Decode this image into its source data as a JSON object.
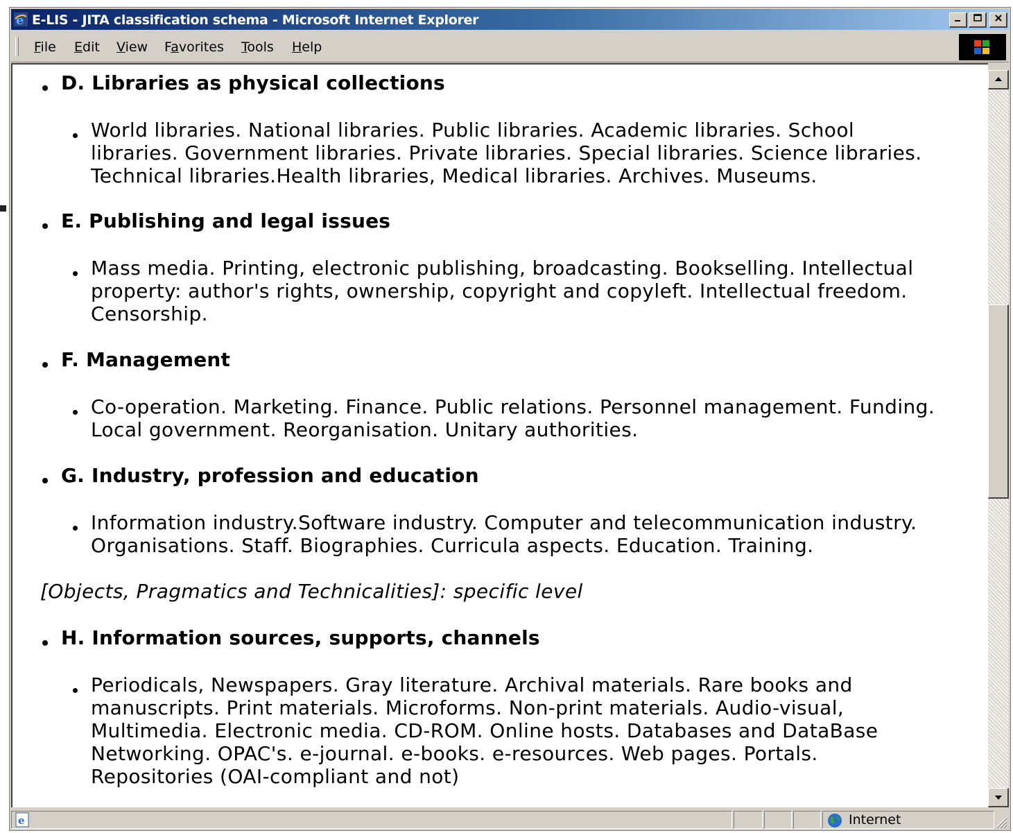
{
  "window": {
    "title": "E-LIS - JITA classification schema - Microsoft Internet Explorer"
  },
  "menu": [
    "File",
    "Edit",
    "View",
    "Favorites",
    "Tools",
    "Help"
  ],
  "sections": [
    {
      "heading": "D. Libraries as physical collections",
      "lines": [
        "World libraries. National libraries. Public libraries. Academic libraries. School",
        "libraries. Government libraries. Private libraries. Special libraries. Science libraries.",
        "Technical libraries.Health libraries, Medical libraries. Archives. Museums."
      ]
    },
    {
      "heading": "E. Publishing and legal issues",
      "lines": [
        "Mass media. Printing, electronic publishing, broadcasting. Bookselling. Intellectual",
        "property: author's rights, ownership, copyright and copyleft. Intellectual freedom.",
        "Censorship."
      ]
    },
    {
      "heading": "F. Management",
      "lines": [
        "Co-operation. Marketing. Finance. Public relations. Personnel management. Funding.",
        "Local government. Reorganisation. Unitary authorities."
      ]
    },
    {
      "heading": "G. Industry, profession and education",
      "lines": [
        "Information industry.Software industry. Computer and telecommunication industry.",
        "Organisations. Staff. Biographies. Curricula aspects. Education. Training."
      ]
    },
    {
      "heading": "H. Information sources, supports, channels",
      "lines": [
        "Periodicals, Newspapers. Gray literature. Archival materials. Rare books and",
        "manuscripts. Print materials. Microforms. Non-print materials. Audio-visual,",
        "Multimedia. Electronic media. CD-ROM. Online hosts. Databases and DataBase",
        "Networking. OPAC's. e-journal. e-books. e-resources. Web pages. Portals.",
        "Repositories (OAI-compliant and not)"
      ]
    }
  ],
  "level_note": "[Objects, Pragmatics and Technicalities]: specific level",
  "status": {
    "zone": "Internet"
  }
}
